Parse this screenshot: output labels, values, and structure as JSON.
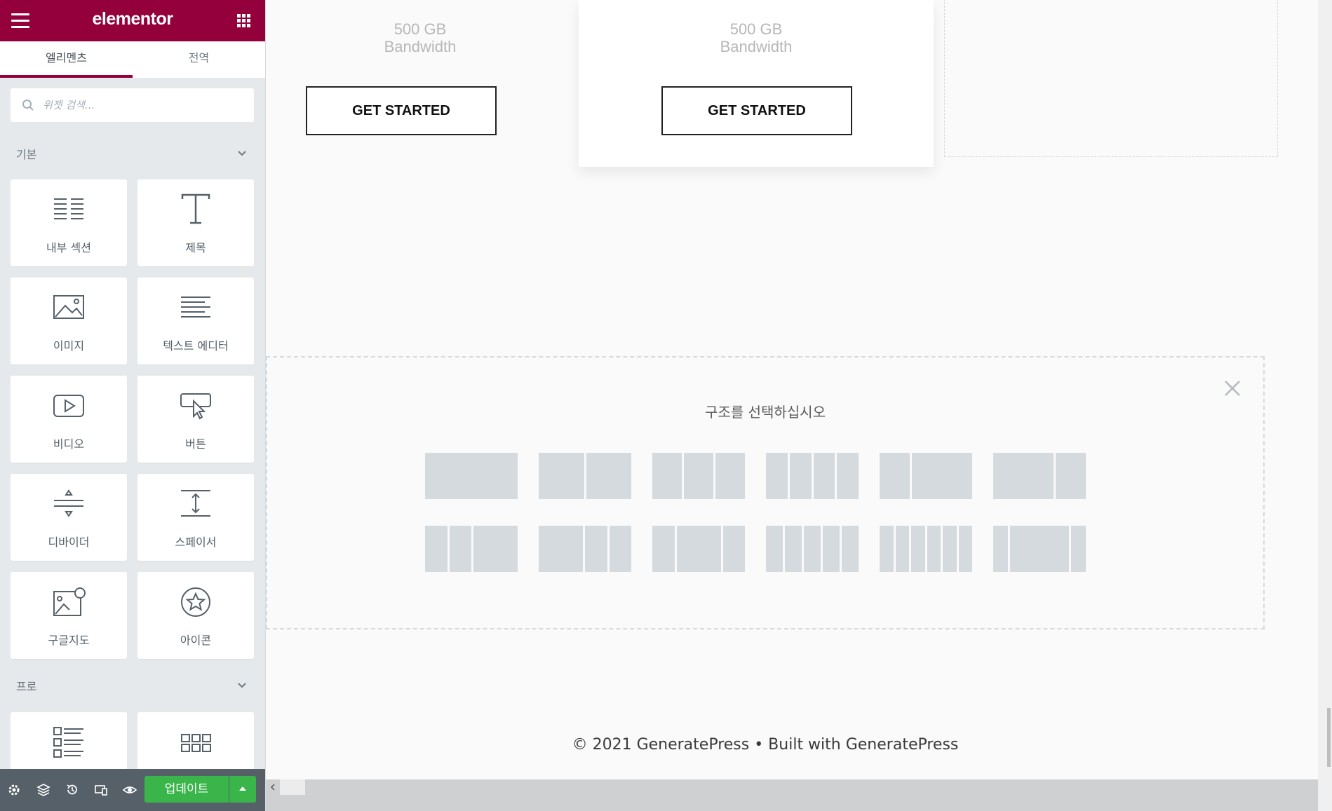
{
  "panel": {
    "brand": "elementor",
    "tabs": [
      "엘리멘츠",
      "전역"
    ],
    "search": {
      "placeholder": "위젯 검색..."
    },
    "categories": [
      {
        "title": "기본",
        "widgets": [
          {
            "label": "내부 섹션",
            "icon": "inner-section-icon"
          },
          {
            "label": "제목",
            "icon": "heading-icon"
          },
          {
            "label": "이미지",
            "icon": "image-icon"
          },
          {
            "label": "텍스트 에디터",
            "icon": "text-editor-icon"
          },
          {
            "label": "비디오",
            "icon": "video-icon"
          },
          {
            "label": "버튼",
            "icon": "button-icon"
          },
          {
            "label": "디바이더",
            "icon": "divider-icon"
          },
          {
            "label": "스페이서",
            "icon": "spacer-icon"
          },
          {
            "label": "구글지도",
            "icon": "google-maps-icon"
          },
          {
            "label": "아이콘",
            "icon": "star-icon"
          }
        ]
      },
      {
        "title": "프로",
        "widgets": [
          {
            "label": "",
            "icon": "posts-icon"
          },
          {
            "label": "",
            "icon": "portfolio-icon"
          }
        ]
      }
    ],
    "footer": {
      "icons": [
        "settings-icon",
        "navigator-icon",
        "history-icon",
        "responsive-icon",
        "preview-icon"
      ],
      "update_label": "업데이트"
    }
  },
  "preview": {
    "pricing": [
      {
        "bandwidth": "500 GB\nBandwidth",
        "cta": "GET STARTED"
      },
      {
        "bandwidth": "500 GB\nBandwidth",
        "cta": "GET STARTED"
      }
    ],
    "structure": {
      "title": "구조를 선택하십시오",
      "presets": [
        [
          100
        ],
        [
          50,
          50
        ],
        [
          33,
          33,
          33
        ],
        [
          25,
          25,
          25,
          25
        ],
        [
          33,
          66
        ],
        [
          66,
          33
        ],
        [
          25,
          25,
          50
        ],
        [
          50,
          25,
          25
        ],
        [
          25,
          50,
          25
        ],
        [
          20,
          20,
          20,
          20,
          20
        ],
        [
          16,
          16,
          16,
          16,
          16,
          16
        ],
        [
          16,
          66,
          16
        ]
      ]
    },
    "footer_text": "© 2021 GeneratePress • Built with GeneratePress"
  },
  "colors": {
    "brand": "#93003c",
    "update": "#39b54a",
    "panel_bg": "#e6e9ec"
  }
}
